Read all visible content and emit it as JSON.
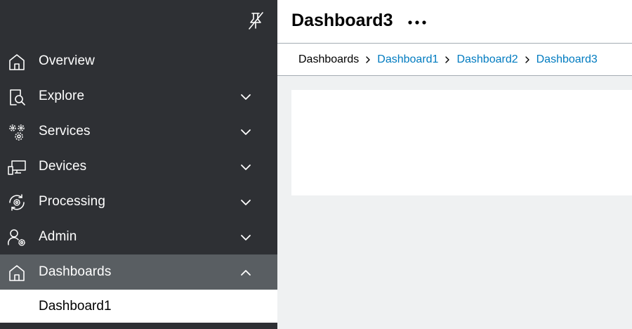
{
  "sidebar": {
    "items": [
      {
        "label": "Overview",
        "icon": "home-icon",
        "expandable": false
      },
      {
        "label": "Explore",
        "icon": "document-search-icon",
        "expandable": true
      },
      {
        "label": "Services",
        "icon": "gears-icon",
        "expandable": true
      },
      {
        "label": "Devices",
        "icon": "devices-icon",
        "expandable": true
      },
      {
        "label": "Processing",
        "icon": "refresh-gear-icon",
        "expandable": true
      },
      {
        "label": "Admin",
        "icon": "user-settings-icon",
        "expandable": true
      },
      {
        "label": "Dashboards",
        "icon": "home-icon",
        "expandable": true,
        "expanded": true,
        "active": true
      }
    ],
    "sub_items": [
      {
        "label": "Dashboard1"
      }
    ],
    "pin_icon": "unpin-icon"
  },
  "header": {
    "title": "Dashboard3",
    "more_icon": "more-horizontal-icon"
  },
  "breadcrumb": [
    {
      "label": "Dashboards",
      "link": false
    },
    {
      "label": "Dashboard1",
      "link": true
    },
    {
      "label": "Dashboard2",
      "link": true
    },
    {
      "label": "Dashboard3",
      "link": true
    }
  ],
  "colors": {
    "sidebar_bg": "#2e3034",
    "sidebar_active_bg": "#595e62",
    "link": "#007bc0",
    "content_bg": "#eff1f2"
  }
}
